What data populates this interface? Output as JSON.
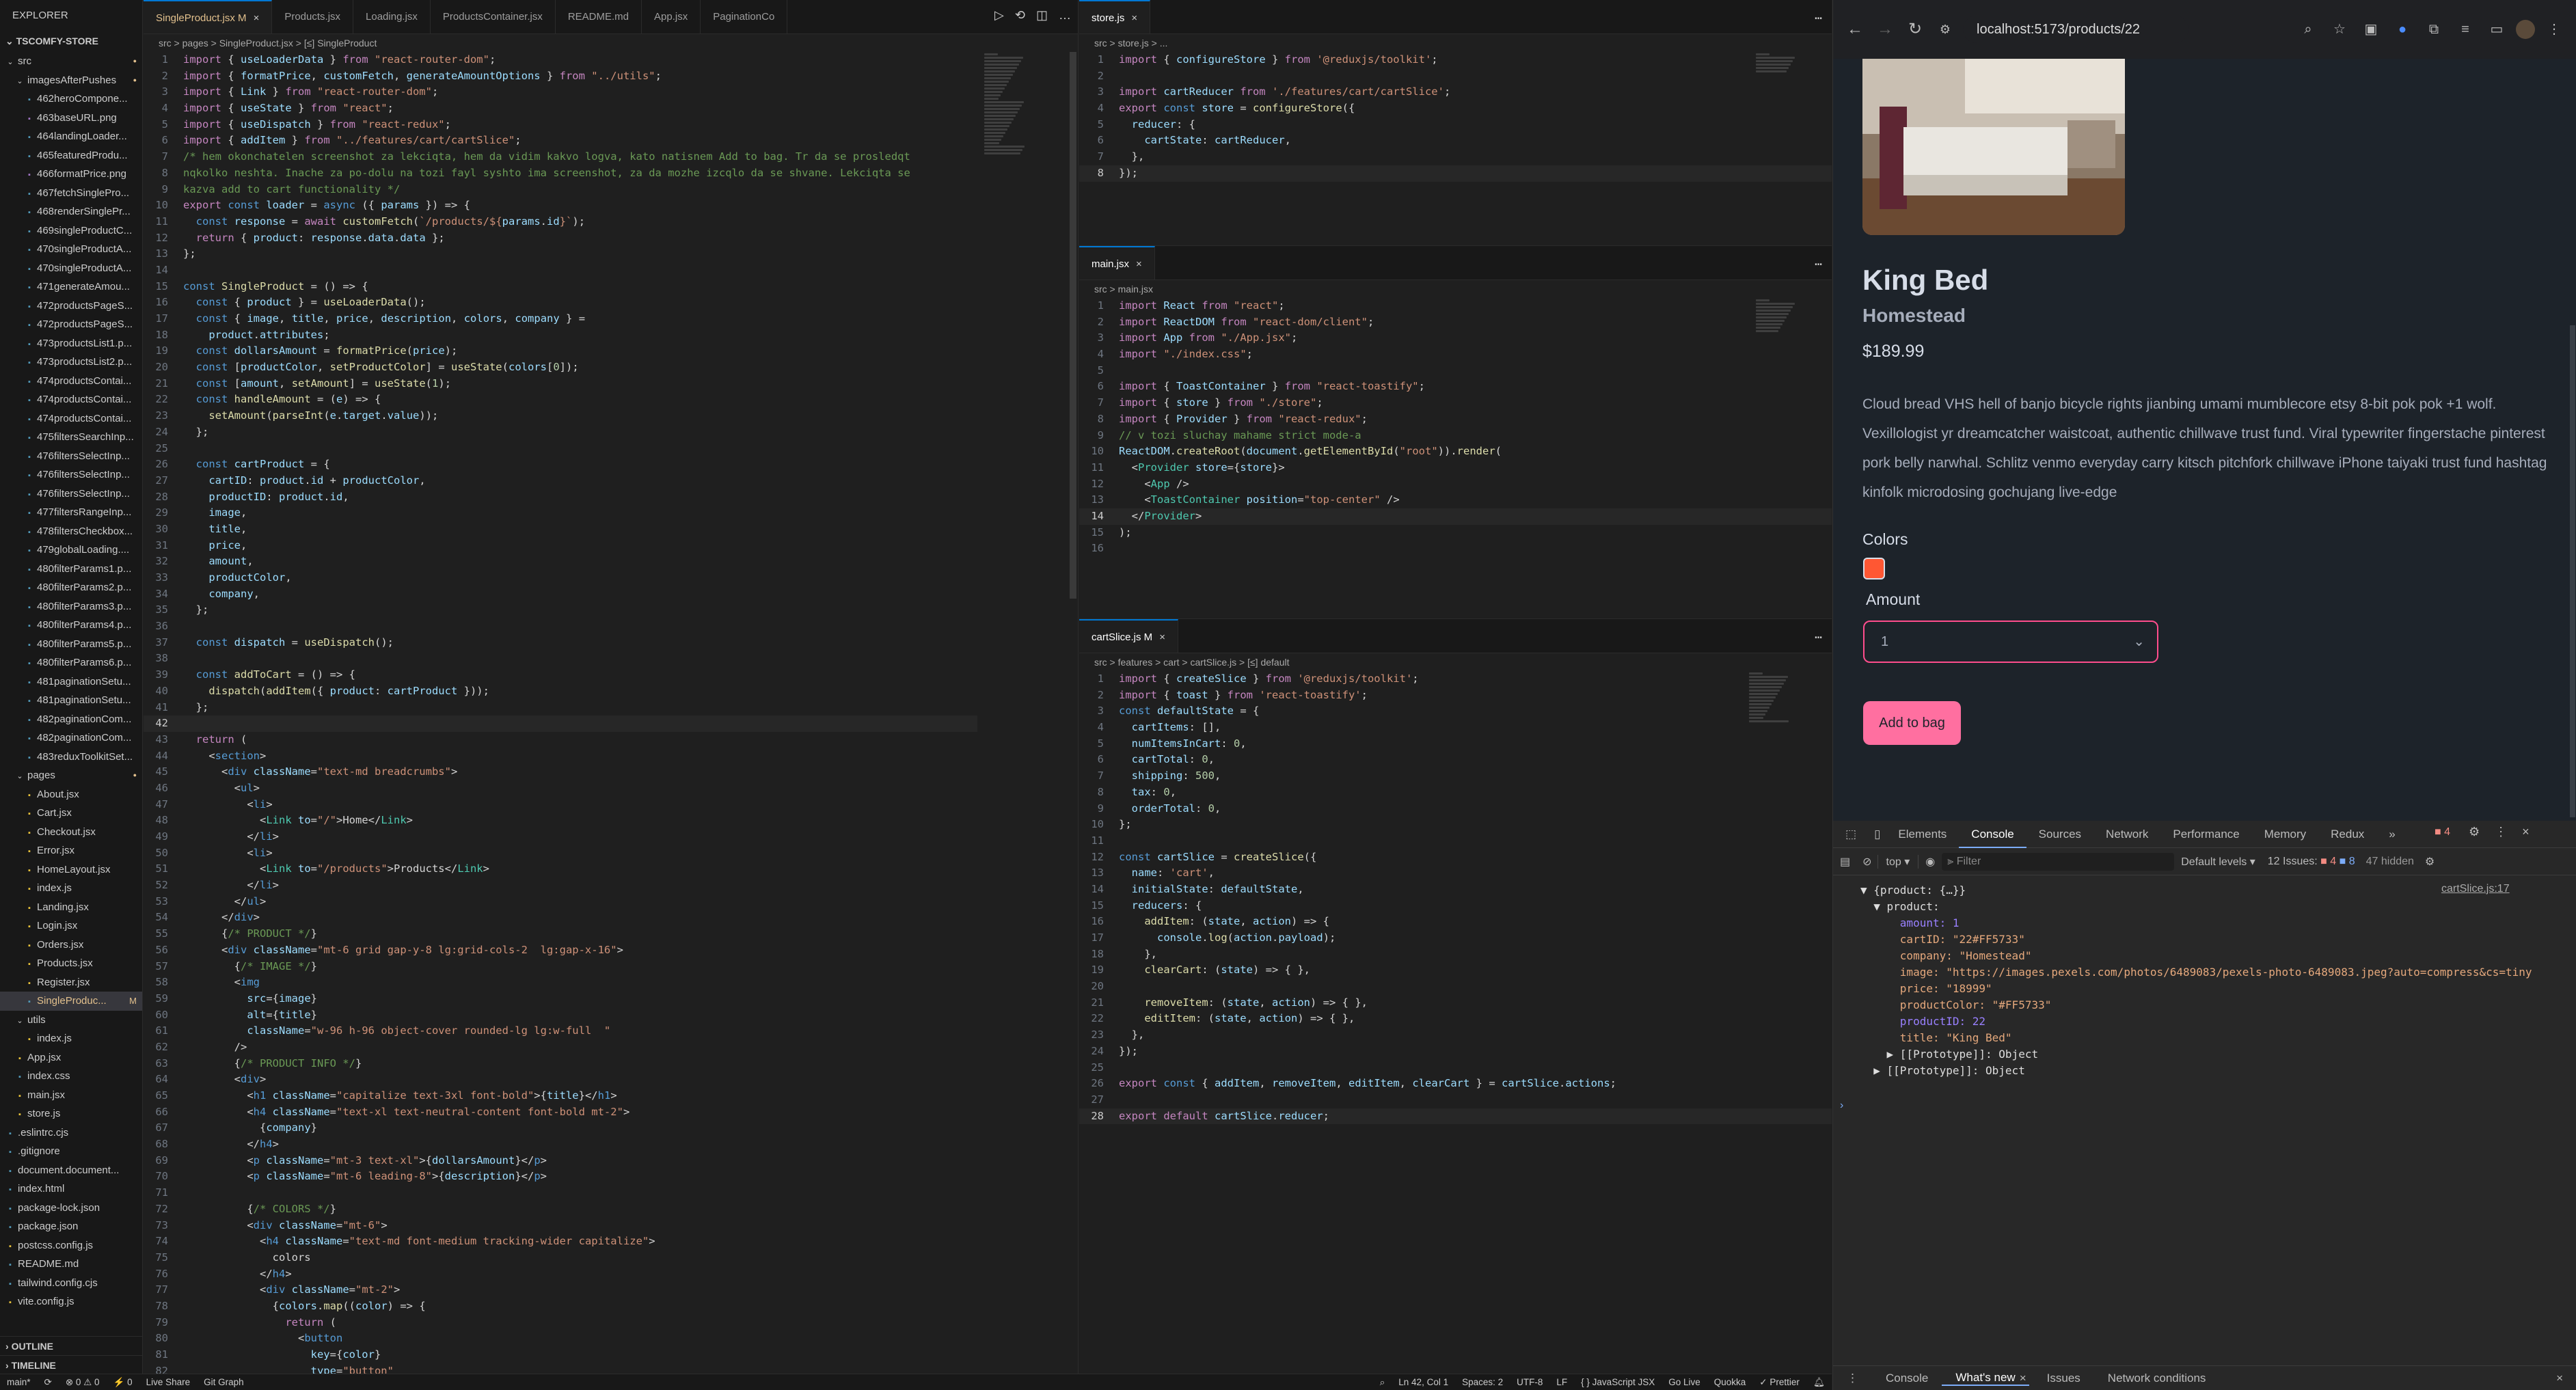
{
  "explorer": {
    "title": "EXPLORER",
    "root": "TSCOMFY-STORE",
    "items": [
      {
        "label": "src",
        "indent": 0,
        "folder": true,
        "dot": true
      },
      {
        "label": "imagesAfterPushes",
        "indent": 1,
        "folder": true,
        "dot": true
      },
      {
        "label": "462heroCompone...",
        "indent": 2
      },
      {
        "label": "463baseURL.png",
        "indent": 2
      },
      {
        "label": "464landingLoader...",
        "indent": 2
      },
      {
        "label": "465featuredProdu...",
        "indent": 2
      },
      {
        "label": "466formatPrice.png",
        "indent": 2
      },
      {
        "label": "467fetchSinglePro...",
        "indent": 2
      },
      {
        "label": "468renderSinglePr...",
        "indent": 2
      },
      {
        "label": "469singleProductC...",
        "indent": 2
      },
      {
        "label": "470singleProductA...",
        "indent": 2
      },
      {
        "label": "470singleProductA...",
        "indent": 2
      },
      {
        "label": "471generateAmou...",
        "indent": 2
      },
      {
        "label": "472productsPageS...",
        "indent": 2
      },
      {
        "label": "472productsPageS...",
        "indent": 2
      },
      {
        "label": "473productsList1.p...",
        "indent": 2
      },
      {
        "label": "473productsList2.p...",
        "indent": 2
      },
      {
        "label": "474productsContai...",
        "indent": 2
      },
      {
        "label": "474productsContai...",
        "indent": 2
      },
      {
        "label": "474productsContai...",
        "indent": 2
      },
      {
        "label": "475filtersSearchInp...",
        "indent": 2
      },
      {
        "label": "476filtersSelectInp...",
        "indent": 2
      },
      {
        "label": "476filtersSelectInp...",
        "indent": 2
      },
      {
        "label": "476filtersSelectInp...",
        "indent": 2
      },
      {
        "label": "477filtersRangeInp...",
        "indent": 2
      },
      {
        "label": "478filtersCheckbox...",
        "indent": 2
      },
      {
        "label": "479globalLoading....",
        "indent": 2
      },
      {
        "label": "480filterParams1.p...",
        "indent": 2
      },
      {
        "label": "480filterParams2.p...",
        "indent": 2
      },
      {
        "label": "480filterParams3.p...",
        "indent": 2
      },
      {
        "label": "480filterParams4.p...",
        "indent": 2
      },
      {
        "label": "480filterParams5.p...",
        "indent": 2
      },
      {
        "label": "480filterParams6.p...",
        "indent": 2
      },
      {
        "label": "481paginationSetu...",
        "indent": 2
      },
      {
        "label": "481paginationSetu...",
        "indent": 2
      },
      {
        "label": "482paginationCom...",
        "indent": 2
      },
      {
        "label": "482paginationCom...",
        "indent": 2
      },
      {
        "label": "483reduxToolkitSet...",
        "indent": 2
      },
      {
        "label": "pages",
        "indent": 1,
        "folder": true,
        "dot": true
      },
      {
        "label": "About.jsx",
        "indent": 2
      },
      {
        "label": "Cart.jsx",
        "indent": 2
      },
      {
        "label": "Checkout.jsx",
        "indent": 2
      },
      {
        "label": "Error.jsx",
        "indent": 2
      },
      {
        "label": "HomeLayout.jsx",
        "indent": 2
      },
      {
        "label": "index.js",
        "indent": 2
      },
      {
        "label": "Landing.jsx",
        "indent": 2
      },
      {
        "label": "Login.jsx",
        "indent": 2
      },
      {
        "label": "Orders.jsx",
        "indent": 2
      },
      {
        "label": "Products.jsx",
        "indent": 2
      },
      {
        "label": "Register.jsx",
        "indent": 2
      },
      {
        "label": "SingleProduc...",
        "indent": 2,
        "active": true,
        "badge": "M"
      },
      {
        "label": "utils",
        "indent": 1,
        "folder": true
      },
      {
        "label": "index.js",
        "indent": 2
      },
      {
        "label": "App.jsx",
        "indent": 1
      },
      {
        "label": "index.css",
        "indent": 1
      },
      {
        "label": "main.jsx",
        "indent": 1
      },
      {
        "label": "store.js",
        "indent": 1
      },
      {
        "label": ".eslintrc.cjs",
        "indent": 0
      },
      {
        "label": ".gitignore",
        "indent": 0
      },
      {
        "label": "document.document...",
        "indent": 0
      },
      {
        "label": "index.html",
        "indent": 0
      },
      {
        "label": "package-lock.json",
        "indent": 0
      },
      {
        "label": "package.json",
        "indent": 0
      },
      {
        "label": "postcss.config.js",
        "indent": 0
      },
      {
        "label": "README.md",
        "indent": 0
      },
      {
        "label": "tailwind.config.cjs",
        "indent": 0
      },
      {
        "label": "vite.config.js",
        "indent": 0
      }
    ],
    "outline": "OUTLINE",
    "timeline": "TIMELINE"
  },
  "left_editor": {
    "tabs": [
      "SingleProduct.jsx  M",
      "Products.jsx",
      "Loading.jsx",
      "ProductsContainer.jsx",
      "README.md",
      "App.jsx",
      "PaginationCo"
    ],
    "breadcrumb": "src > pages > SingleProduct.jsx > [≤] SingleProduct",
    "current_line": 42
  },
  "store_editor": {
    "tab": "store.js",
    "breadcrumb": "src > store.js > ...",
    "current_line": 8
  },
  "main_editor": {
    "tab": "main.jsx",
    "breadcrumb": "src > main.jsx",
    "current_line": 14
  },
  "slice_editor": {
    "tab": "cartSlice.js  M",
    "breadcrumb": "src > features > cart > cartSlice.js > [≤] default",
    "current_line": 28
  },
  "status": {
    "branch": "main*",
    "sync": "⟳",
    "problems": "⊗ 0 ⚠ 0",
    "ports": "⚡ 0",
    "live_share": "Live Share",
    "git_graph": "Git Graph",
    "position": "Ln 42, Col 1",
    "spaces": "Spaces: 2",
    "encoding": "UTF-8",
    "eol": "LF",
    "language": "{ } JavaScript JSX",
    "go_live": "Go Live",
    "quokka": "Quokka",
    "prettier": "✓ Prettier"
  },
  "browser": {
    "url": "localhost:5173/products/22",
    "product": {
      "title": "King Bed",
      "company": "Homestead",
      "price": "$189.99",
      "description": "Cloud bread VHS hell of banjo bicycle rights jianbing umami mumblecore etsy 8-bit pok pok +1 wolf. Vexillologist yr dreamcatcher waistcoat, authentic chillwave trust fund. Viral typewriter fingerstache pinterest pork belly narwhal. Schlitz venmo everyday carry kitsch pitchfork chillwave iPhone taiyaki trust fund hashtag kinfolk microdosing gochujang live-edge",
      "colors_label": "Colors",
      "color_swatch": "#FF5733",
      "amount_label": "Amount",
      "amount_value": "1",
      "button": "Add to bag"
    }
  },
  "devtools": {
    "tabs": [
      "Elements",
      "Console",
      "Sources",
      "Network",
      "Performance",
      "Memory",
      "Redux"
    ],
    "active_tab": "Console",
    "errors": "4",
    "context": "top",
    "filter_placeholder": "Filter",
    "levels": "Default levels",
    "issues": "12 Issues: ",
    "issues_err": "4",
    "issues_info": "8",
    "hidden": "47 hidden",
    "source_link": "cartSlice.js:17",
    "log": [
      "▼ {product: {…}}",
      "  ▼ product:",
      "      amount: 1",
      "      cartID: \"22#FF5733\"",
      "      company: \"Homestead\"",
      "      image: \"https://images.pexels.com/photos/6489083/pexels-photo-6489083.jpeg?auto=compress&cs=tiny",
      "      price: \"18999\"",
      "      productColor: \"#FF5733\"",
      "      productID: 22",
      "      title: \"King Bed\"",
      "    ▶ [[Prototype]]: Object",
      "  ▶ [[Prototype]]: Object"
    ],
    "drawer_tabs": [
      "Console",
      "What's new",
      "Issues",
      "Network conditions"
    ]
  }
}
